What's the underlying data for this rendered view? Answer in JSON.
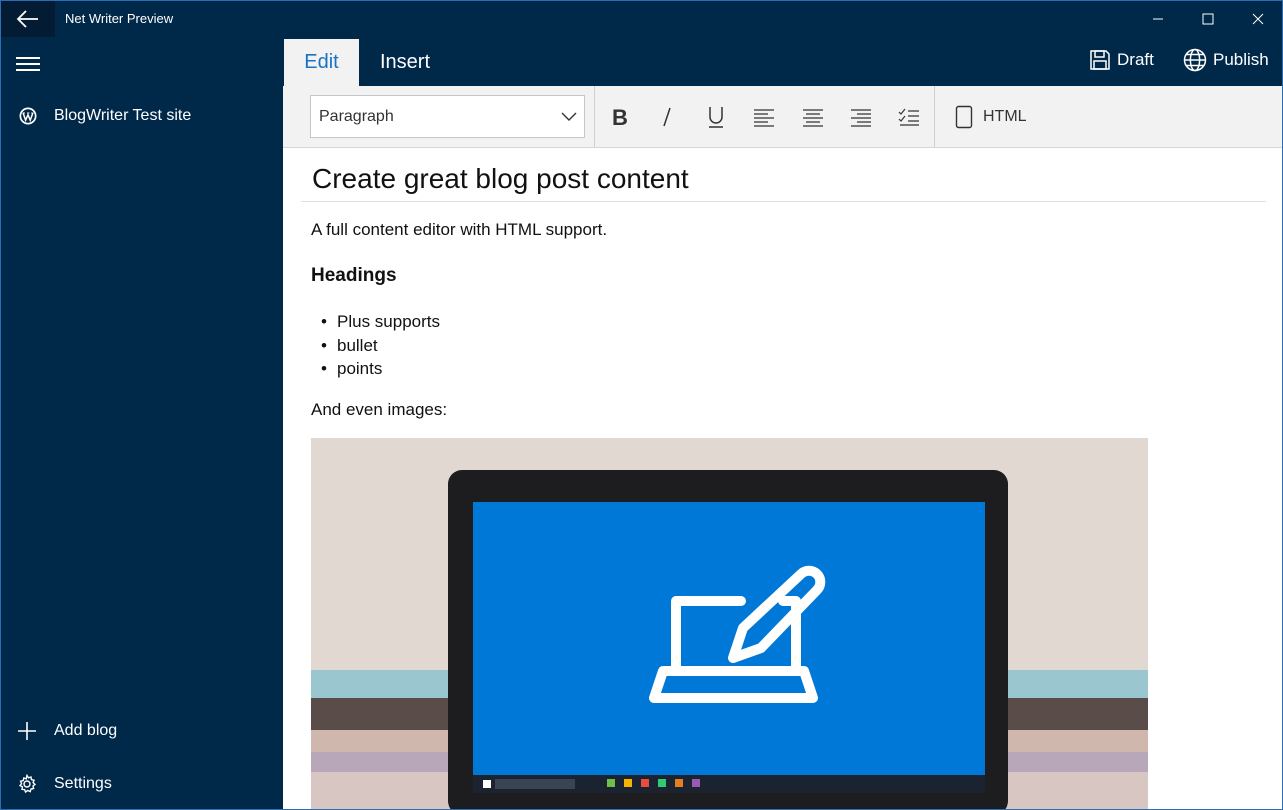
{
  "window": {
    "title": "Net Writer Preview",
    "accent": "#002849",
    "title_accent": "#2a6fb6"
  },
  "sidebar": {
    "blog_name": "BlogWriter Test site",
    "blog_icon": "wordpress-icon",
    "add_blog_label": "Add blog",
    "settings_label": "Settings"
  },
  "header": {
    "tabs": [
      {
        "label": "Edit",
        "selected": true
      },
      {
        "label": "Insert",
        "selected": false
      }
    ],
    "draft_label": "Draft",
    "publish_label": "Publish"
  },
  "toolbar": {
    "paragraph_style": "Paragraph",
    "buttons": [
      "bold-icon",
      "italic-icon",
      "underline-icon",
      "align-left-icon",
      "align-center-icon",
      "align-right-icon",
      "checklist-icon"
    ],
    "html_label": "HTML"
  },
  "editor": {
    "title": "Create great blog post content",
    "intro": "A full content editor with HTML support.",
    "heading": "Headings",
    "bullets": [
      "Plus supports",
      "bullet",
      "points"
    ],
    "images_line": "And even images:",
    "link_color": "#1a73c1"
  }
}
